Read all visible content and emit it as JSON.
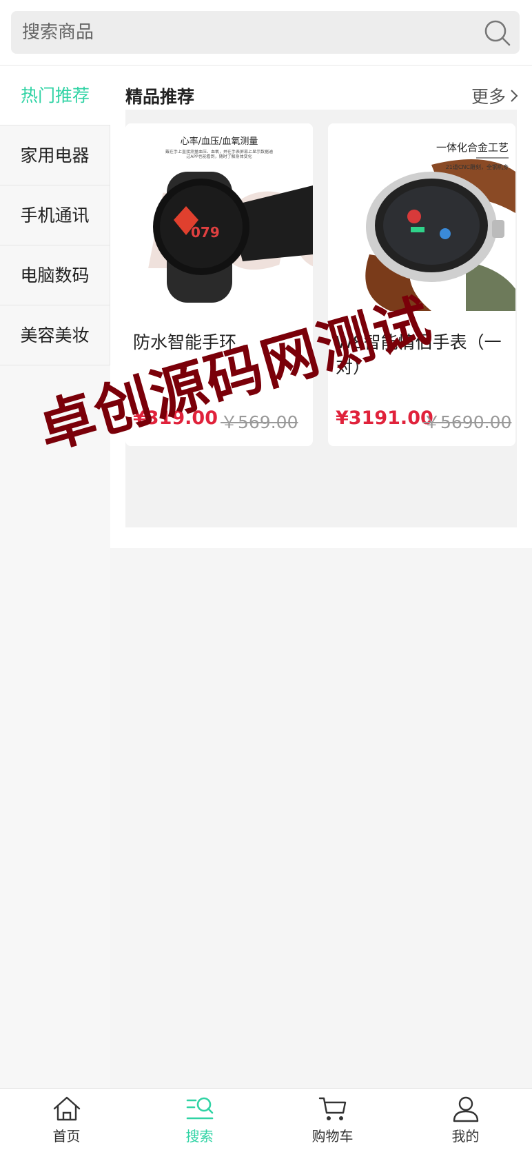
{
  "search": {
    "placeholder": "搜索商品"
  },
  "sidebar": {
    "items": [
      {
        "label": "热门推荐",
        "active": true
      },
      {
        "label": "家用电器"
      },
      {
        "label": "手机通讯"
      },
      {
        "label": "电脑数码"
      },
      {
        "label": "美容美妆"
      }
    ]
  },
  "section": {
    "title": "精品推荐",
    "more": "更多"
  },
  "products": [
    {
      "name": "防水智能手环",
      "price": "¥319.00",
      "old_price": "￥569.00",
      "image_heading": "心率/血压/血氧测量",
      "image_sub": "戴在手上直接测量血压、血氧，并在手表屏幕上显示数据通过APP也能看到，随时了解身体变化",
      "image_letters": "ECG",
      "watch_text": "079"
    },
    {
      "name": "W8智能情侣手表（一对）",
      "price": "¥3191.00",
      "old_price": "￥5690.00",
      "image_heading": "一体化合金工艺",
      "image_sub": "21道CNC雕刻，全钢机身"
    }
  ],
  "watermark": "卓创源码网测试",
  "tabbar": {
    "items": [
      {
        "label": "首页",
        "icon": "home-icon"
      },
      {
        "label": "搜索",
        "icon": "search-list-icon",
        "active": true
      },
      {
        "label": "购物车",
        "icon": "cart-icon"
      },
      {
        "label": "我的",
        "icon": "user-icon"
      }
    ]
  },
  "colors": {
    "accent": "#2fd3a4",
    "price": "#e0223b",
    "watermark": "#7a0009"
  }
}
